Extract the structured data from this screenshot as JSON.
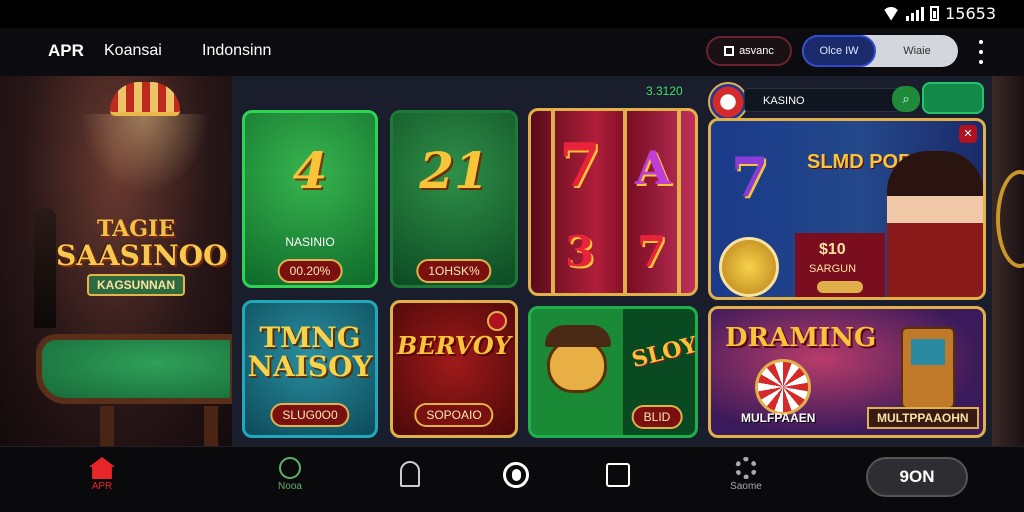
{
  "status_bar": {
    "time": "15653"
  },
  "header": {
    "brand": "APR",
    "subtitle": "Koansai",
    "region": "Indonsinn",
    "account_button": "asvanc",
    "toggle": {
      "active": "Olce IW",
      "inactive": "Wiaie"
    }
  },
  "banner": {
    "line1": "TAGIE",
    "line2": "SAASINOO",
    "line3": "KAGSUNNAN"
  },
  "balance": "3.3120",
  "games": [
    {
      "title": "4",
      "label": "NASINIO",
      "pill": "00.20%"
    },
    {
      "title": "21",
      "pill": "1OHSK%"
    },
    {
      "title": "7",
      "reel_values": [
        "7",
        "A",
        "3",
        "7"
      ]
    },
    {
      "brand": "KASINO",
      "title7": "7",
      "title": "SLMD POBLX",
      "number": "$10",
      "sub": "SARGUN"
    },
    {
      "title": "TMNG NAISOY",
      "pill": "SLUG0O0"
    },
    {
      "title": "BERVOY",
      "pill": "SOPOAIO"
    },
    {
      "title": "SLOYN",
      "pill": "BLID"
    },
    {
      "title": "DRAMING",
      "sub": "MULFPAAEN",
      "pill": "MULTPPAAOHN"
    }
  ],
  "nav": {
    "home": "APR",
    "news": "Nooa",
    "settings": "Saome",
    "join": "9ON"
  }
}
